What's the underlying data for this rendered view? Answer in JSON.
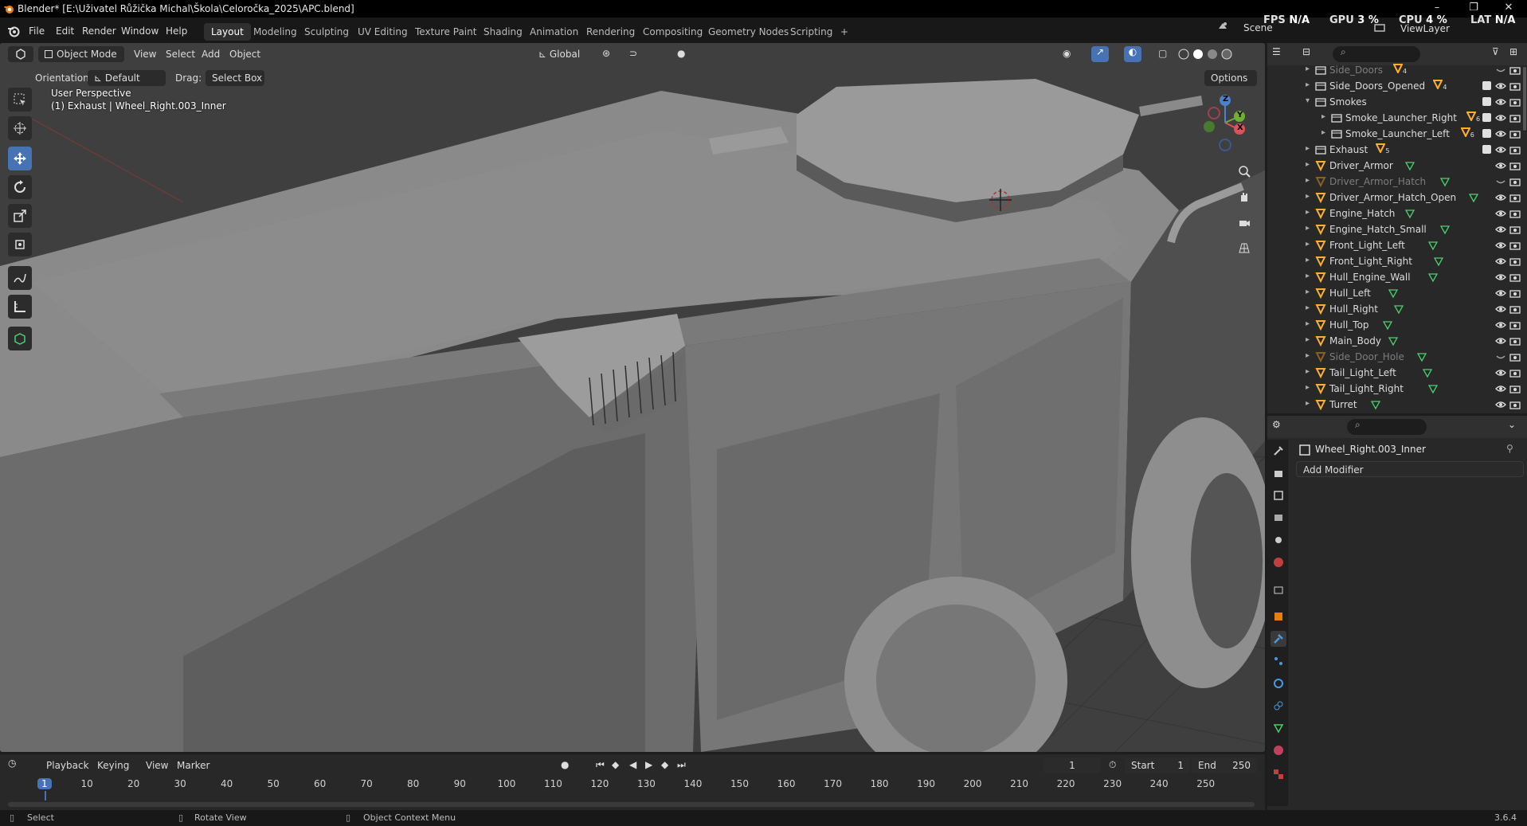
{
  "window": {
    "title": "Blender* [E:\\Uživatel Růžička Michal\\Škola\\Celoročka_2025\\APC.blend]",
    "min": "–",
    "max": "❐",
    "close": "✕"
  },
  "menu": {
    "file": "File",
    "edit": "Edit",
    "render": "Render",
    "window": "Window",
    "help": "Help"
  },
  "workspaces": [
    "Layout",
    "Modeling",
    "Sculpting",
    "UV Editing",
    "Texture Paint",
    "Shading",
    "Animation",
    "Rendering",
    "Compositing",
    "Geometry Nodes",
    "Scripting"
  ],
  "workspace_add": "+",
  "stats": {
    "fps_label": "FPS",
    "fps": "N/A",
    "gpu_label": "GPU",
    "gpu": "3 %",
    "cpu_label": "CPU",
    "cpu": "4 %",
    "lat_label": "LAT",
    "lat": "N/A"
  },
  "scene": {
    "scene": "Scene",
    "view_layer": "ViewLayer"
  },
  "viewport": {
    "mode": "Object Mode",
    "view": "View",
    "select": "Select",
    "add": "Add",
    "object": "Object",
    "transform_space": "Global",
    "orientation_label": "Orientation:",
    "orientation": "Default",
    "drag_label": "Drag:",
    "drag": "Select Box",
    "options": "Options",
    "overlay_title": "User Perspective",
    "overlay_sub": "(1) Exhaust | Wheel_Right.003_Inner",
    "axes": {
      "x": "X",
      "y": "Y",
      "z": "Z"
    }
  },
  "outliner": {
    "items": [
      {
        "label": "Side_Doors",
        "kind": "collection",
        "depth": 0,
        "dim": true,
        "badge": "4",
        "expand": "▸"
      },
      {
        "label": "Side_Doors_Opened",
        "kind": "collection",
        "depth": 0,
        "dim": false,
        "badge": "4",
        "expand": "▸"
      },
      {
        "label": "Smokes",
        "kind": "collection",
        "depth": 0,
        "dim": false,
        "badge": "",
        "expand": "▾"
      },
      {
        "label": "Smoke_Launcher_Right",
        "kind": "collection",
        "depth": 1,
        "dim": false,
        "badge": "6",
        "expand": "▸"
      },
      {
        "label": "Smoke_Launcher_Left",
        "kind": "collection",
        "depth": 1,
        "dim": false,
        "badge": "6",
        "expand": "▸"
      },
      {
        "label": "Exhaust",
        "kind": "collection",
        "depth": 0,
        "dim": false,
        "badge": "5",
        "expand": "▸"
      },
      {
        "label": "Driver_Armor",
        "kind": "mesh",
        "depth": 0,
        "dim": false,
        "badge": "",
        "expand": "▸"
      },
      {
        "label": "Driver_Armor_Hatch",
        "kind": "mesh",
        "depth": 0,
        "dim": true,
        "badge": "",
        "expand": "▸"
      },
      {
        "label": "Driver_Armor_Hatch_Open",
        "kind": "mesh",
        "depth": 0,
        "dim": false,
        "badge": "",
        "expand": "▸"
      },
      {
        "label": "Engine_Hatch",
        "kind": "mesh",
        "depth": 0,
        "dim": false,
        "badge": "",
        "expand": "▸"
      },
      {
        "label": "Engine_Hatch_Small",
        "kind": "mesh",
        "depth": 0,
        "dim": false,
        "badge": "",
        "expand": "▸"
      },
      {
        "label": "Front_Light_Left",
        "kind": "mesh",
        "depth": 0,
        "dim": false,
        "badge": "",
        "expand": "▸"
      },
      {
        "label": "Front_Light_Right",
        "kind": "mesh",
        "depth": 0,
        "dim": false,
        "badge": "",
        "expand": "▸"
      },
      {
        "label": "Hull_Engine_Wall",
        "kind": "mesh",
        "depth": 0,
        "dim": false,
        "badge": "",
        "expand": "▸"
      },
      {
        "label": "Hull_Left",
        "kind": "mesh",
        "depth": 0,
        "dim": false,
        "badge": "",
        "expand": "▸"
      },
      {
        "label": "Hull_Right",
        "kind": "mesh",
        "depth": 0,
        "dim": false,
        "badge": "",
        "expand": "▸"
      },
      {
        "label": "Hull_Top",
        "kind": "mesh",
        "depth": 0,
        "dim": false,
        "badge": "",
        "expand": "▸"
      },
      {
        "label": "Main_Body",
        "kind": "mesh",
        "depth": 0,
        "dim": false,
        "badge": "",
        "expand": "▸"
      },
      {
        "label": "Side_Door_Hole",
        "kind": "mesh",
        "depth": 0,
        "dim": true,
        "badge": "",
        "expand": "▸"
      },
      {
        "label": "Tail_Light_Left",
        "kind": "mesh",
        "depth": 0,
        "dim": false,
        "badge": "",
        "expand": "▸"
      },
      {
        "label": "Tail_Light_Right",
        "kind": "mesh",
        "depth": 0,
        "dim": false,
        "badge": "",
        "expand": "▸"
      },
      {
        "label": "Turret",
        "kind": "mesh",
        "depth": 0,
        "dim": false,
        "badge": "",
        "expand": "▸"
      }
    ]
  },
  "properties": {
    "object_name": "Wheel_Right.003_Inner",
    "add_modifier": "Add Modifier"
  },
  "timeline": {
    "playback": "Playback",
    "keying": "Keying",
    "view": "View",
    "marker": "Marker",
    "current_frame": "1",
    "start_label": "Start",
    "start": "1",
    "end_label": "End",
    "end": "250",
    "ticks": [
      "1",
      "10",
      "20",
      "30",
      "40",
      "50",
      "60",
      "70",
      "80",
      "90",
      "100",
      "110",
      "120",
      "130",
      "140",
      "150",
      "160",
      "170",
      "180",
      "190",
      "200",
      "210",
      "220",
      "230",
      "240",
      "250"
    ]
  },
  "status": {
    "select": "Select",
    "rotate": "Rotate View",
    "context": "Object Context Menu",
    "version": "3.6.4"
  },
  "colors": {
    "accent": "#4772b3",
    "mesh_icon": "#ffaf29",
    "mesh_data": "#4bcf6e",
    "viewport_bg": "#3d3d3d"
  }
}
